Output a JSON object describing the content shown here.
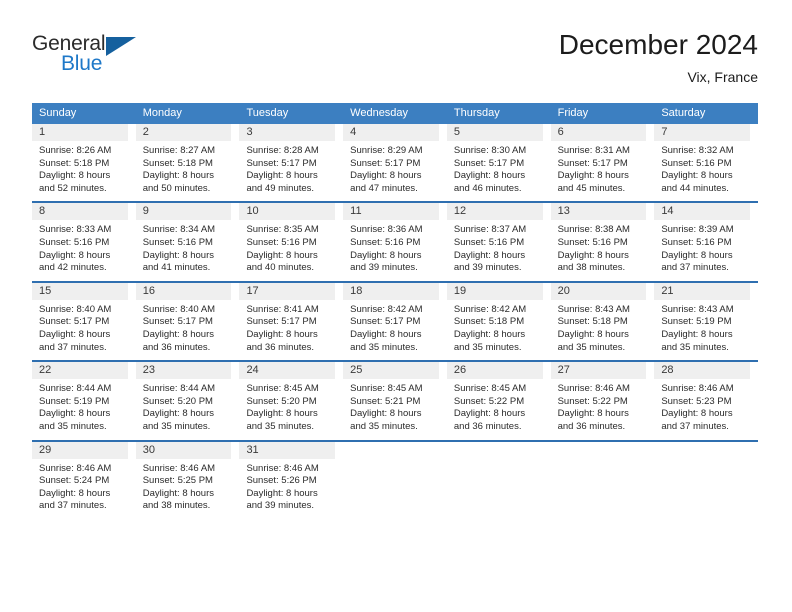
{
  "brand": {
    "name_part1": "General",
    "name_part2": "Blue"
  },
  "header": {
    "title": "December 2024",
    "location": "Vix, France"
  },
  "weekdays": [
    "Sunday",
    "Monday",
    "Tuesday",
    "Wednesday",
    "Thursday",
    "Friday",
    "Saturday"
  ],
  "colors": {
    "header_blue": "#3c7fc1",
    "row_divider_blue": "#2f6fb0",
    "day_band_gray": "#efefef",
    "logo_blue": "#1e78c8",
    "logo_triangle": "#15609e",
    "text": "#2b2b2b"
  },
  "weeks": [
    [
      {
        "day": "1",
        "sunrise": "Sunrise: 8:26 AM",
        "sunset": "Sunset: 5:18 PM",
        "daylight1": "Daylight: 8 hours",
        "daylight2": "and 52 minutes."
      },
      {
        "day": "2",
        "sunrise": "Sunrise: 8:27 AM",
        "sunset": "Sunset: 5:18 PM",
        "daylight1": "Daylight: 8 hours",
        "daylight2": "and 50 minutes."
      },
      {
        "day": "3",
        "sunrise": "Sunrise: 8:28 AM",
        "sunset": "Sunset: 5:17 PM",
        "daylight1": "Daylight: 8 hours",
        "daylight2": "and 49 minutes."
      },
      {
        "day": "4",
        "sunrise": "Sunrise: 8:29 AM",
        "sunset": "Sunset: 5:17 PM",
        "daylight1": "Daylight: 8 hours",
        "daylight2": "and 47 minutes."
      },
      {
        "day": "5",
        "sunrise": "Sunrise: 8:30 AM",
        "sunset": "Sunset: 5:17 PM",
        "daylight1": "Daylight: 8 hours",
        "daylight2": "and 46 minutes."
      },
      {
        "day": "6",
        "sunrise": "Sunrise: 8:31 AM",
        "sunset": "Sunset: 5:17 PM",
        "daylight1": "Daylight: 8 hours",
        "daylight2": "and 45 minutes."
      },
      {
        "day": "7",
        "sunrise": "Sunrise: 8:32 AM",
        "sunset": "Sunset: 5:16 PM",
        "daylight1": "Daylight: 8 hours",
        "daylight2": "and 44 minutes."
      }
    ],
    [
      {
        "day": "8",
        "sunrise": "Sunrise: 8:33 AM",
        "sunset": "Sunset: 5:16 PM",
        "daylight1": "Daylight: 8 hours",
        "daylight2": "and 42 minutes."
      },
      {
        "day": "9",
        "sunrise": "Sunrise: 8:34 AM",
        "sunset": "Sunset: 5:16 PM",
        "daylight1": "Daylight: 8 hours",
        "daylight2": "and 41 minutes."
      },
      {
        "day": "10",
        "sunrise": "Sunrise: 8:35 AM",
        "sunset": "Sunset: 5:16 PM",
        "daylight1": "Daylight: 8 hours",
        "daylight2": "and 40 minutes."
      },
      {
        "day": "11",
        "sunrise": "Sunrise: 8:36 AM",
        "sunset": "Sunset: 5:16 PM",
        "daylight1": "Daylight: 8 hours",
        "daylight2": "and 39 minutes."
      },
      {
        "day": "12",
        "sunrise": "Sunrise: 8:37 AM",
        "sunset": "Sunset: 5:16 PM",
        "daylight1": "Daylight: 8 hours",
        "daylight2": "and 39 minutes."
      },
      {
        "day": "13",
        "sunrise": "Sunrise: 8:38 AM",
        "sunset": "Sunset: 5:16 PM",
        "daylight1": "Daylight: 8 hours",
        "daylight2": "and 38 minutes."
      },
      {
        "day": "14",
        "sunrise": "Sunrise: 8:39 AM",
        "sunset": "Sunset: 5:16 PM",
        "daylight1": "Daylight: 8 hours",
        "daylight2": "and 37 minutes."
      }
    ],
    [
      {
        "day": "15",
        "sunrise": "Sunrise: 8:40 AM",
        "sunset": "Sunset: 5:17 PM",
        "daylight1": "Daylight: 8 hours",
        "daylight2": "and 37 minutes."
      },
      {
        "day": "16",
        "sunrise": "Sunrise: 8:40 AM",
        "sunset": "Sunset: 5:17 PM",
        "daylight1": "Daylight: 8 hours",
        "daylight2": "and 36 minutes."
      },
      {
        "day": "17",
        "sunrise": "Sunrise: 8:41 AM",
        "sunset": "Sunset: 5:17 PM",
        "daylight1": "Daylight: 8 hours",
        "daylight2": "and 36 minutes."
      },
      {
        "day": "18",
        "sunrise": "Sunrise: 8:42 AM",
        "sunset": "Sunset: 5:17 PM",
        "daylight1": "Daylight: 8 hours",
        "daylight2": "and 35 minutes."
      },
      {
        "day": "19",
        "sunrise": "Sunrise: 8:42 AM",
        "sunset": "Sunset: 5:18 PM",
        "daylight1": "Daylight: 8 hours",
        "daylight2": "and 35 minutes."
      },
      {
        "day": "20",
        "sunrise": "Sunrise: 8:43 AM",
        "sunset": "Sunset: 5:18 PM",
        "daylight1": "Daylight: 8 hours",
        "daylight2": "and 35 minutes."
      },
      {
        "day": "21",
        "sunrise": "Sunrise: 8:43 AM",
        "sunset": "Sunset: 5:19 PM",
        "daylight1": "Daylight: 8 hours",
        "daylight2": "and 35 minutes."
      }
    ],
    [
      {
        "day": "22",
        "sunrise": "Sunrise: 8:44 AM",
        "sunset": "Sunset: 5:19 PM",
        "daylight1": "Daylight: 8 hours",
        "daylight2": "and 35 minutes."
      },
      {
        "day": "23",
        "sunrise": "Sunrise: 8:44 AM",
        "sunset": "Sunset: 5:20 PM",
        "daylight1": "Daylight: 8 hours",
        "daylight2": "and 35 minutes."
      },
      {
        "day": "24",
        "sunrise": "Sunrise: 8:45 AM",
        "sunset": "Sunset: 5:20 PM",
        "daylight1": "Daylight: 8 hours",
        "daylight2": "and 35 minutes."
      },
      {
        "day": "25",
        "sunrise": "Sunrise: 8:45 AM",
        "sunset": "Sunset: 5:21 PM",
        "daylight1": "Daylight: 8 hours",
        "daylight2": "and 35 minutes."
      },
      {
        "day": "26",
        "sunrise": "Sunrise: 8:45 AM",
        "sunset": "Sunset: 5:22 PM",
        "daylight1": "Daylight: 8 hours",
        "daylight2": "and 36 minutes."
      },
      {
        "day": "27",
        "sunrise": "Sunrise: 8:46 AM",
        "sunset": "Sunset: 5:22 PM",
        "daylight1": "Daylight: 8 hours",
        "daylight2": "and 36 minutes."
      },
      {
        "day": "28",
        "sunrise": "Sunrise: 8:46 AM",
        "sunset": "Sunset: 5:23 PM",
        "daylight1": "Daylight: 8 hours",
        "daylight2": "and 37 minutes."
      }
    ],
    [
      {
        "day": "29",
        "sunrise": "Sunrise: 8:46 AM",
        "sunset": "Sunset: 5:24 PM",
        "daylight1": "Daylight: 8 hours",
        "daylight2": "and 37 minutes."
      },
      {
        "day": "30",
        "sunrise": "Sunrise: 8:46 AM",
        "sunset": "Sunset: 5:25 PM",
        "daylight1": "Daylight: 8 hours",
        "daylight2": "and 38 minutes."
      },
      {
        "day": "31",
        "sunrise": "Sunrise: 8:46 AM",
        "sunset": "Sunset: 5:26 PM",
        "daylight1": "Daylight: 8 hours",
        "daylight2": "and 39 minutes."
      },
      {
        "day": "",
        "sunrise": "",
        "sunset": "",
        "daylight1": "",
        "daylight2": ""
      },
      {
        "day": "",
        "sunrise": "",
        "sunset": "",
        "daylight1": "",
        "daylight2": ""
      },
      {
        "day": "",
        "sunrise": "",
        "sunset": "",
        "daylight1": "",
        "daylight2": ""
      },
      {
        "day": "",
        "sunrise": "",
        "sunset": "",
        "daylight1": "",
        "daylight2": ""
      }
    ]
  ]
}
